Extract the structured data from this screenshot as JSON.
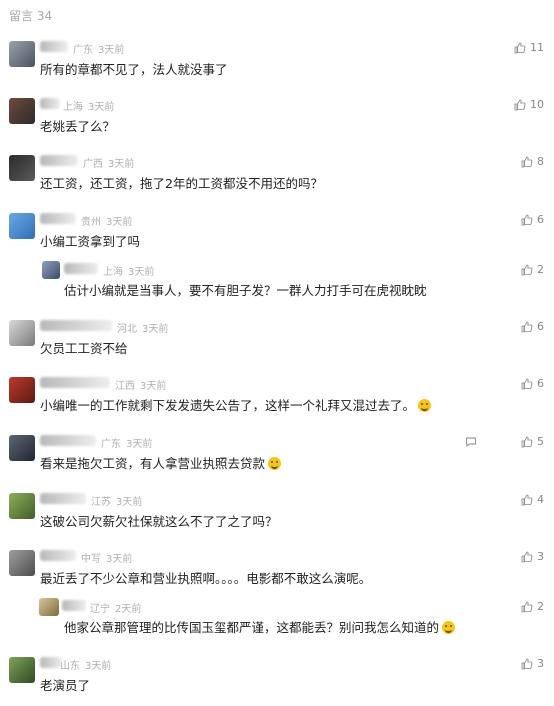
{
  "header": {
    "title": "留言 34"
  },
  "comments": [
    {
      "location": "广东",
      "time": "3天前",
      "text": "所有的章都不见了，法人就没事了",
      "likes": "11"
    },
    {
      "location": "上海",
      "time": "3天前",
      "text": "老姚丢了么？",
      "likes": "10"
    },
    {
      "location": "广西",
      "time": "3天前",
      "text": "还工资，还工资，拖了2年的工资都没不用还的吗？",
      "likes": "8"
    },
    {
      "location": "贵州",
      "time": "3天前",
      "text": "小编工资拿到了吗",
      "likes": "6"
    },
    {
      "location": "上海",
      "time": "3天前",
      "text": "估计小编就是当事人，要不有胆子发？一群人力打手可在虎视眈眈",
      "likes": "2"
    },
    {
      "location": "河北",
      "time": "3天前",
      "text": "欠员工工资不给",
      "likes": "6"
    },
    {
      "location": "江西",
      "time": "3天前",
      "text": "小编唯一的工作就剩下发发遗失公告了，这样一个礼拜又混过去了。",
      "likes": "6"
    },
    {
      "location": "广东",
      "time": "3天前",
      "text": "看来是拖欠工资，有人拿营业执照去贷款",
      "likes": "5"
    },
    {
      "location": "江苏",
      "time": "3天前",
      "text": "这破公司欠薪欠社保就这么不了了之了吗？",
      "likes": "4"
    },
    {
      "location": "中写",
      "time": "3天前",
      "text": "最近丢了不少公章和营业执照啊。。。。电影都不敢这么演呢。",
      "likes": "3"
    },
    {
      "location": "辽宁",
      "time": "2天前",
      "text": "他家公章那管理的比传国玉玺都严谨，这都能丢？别问我怎么知道的",
      "likes": "2"
    },
    {
      "location": "山东",
      "time": "3天前",
      "text": "老演员了",
      "likes": "3"
    }
  ]
}
